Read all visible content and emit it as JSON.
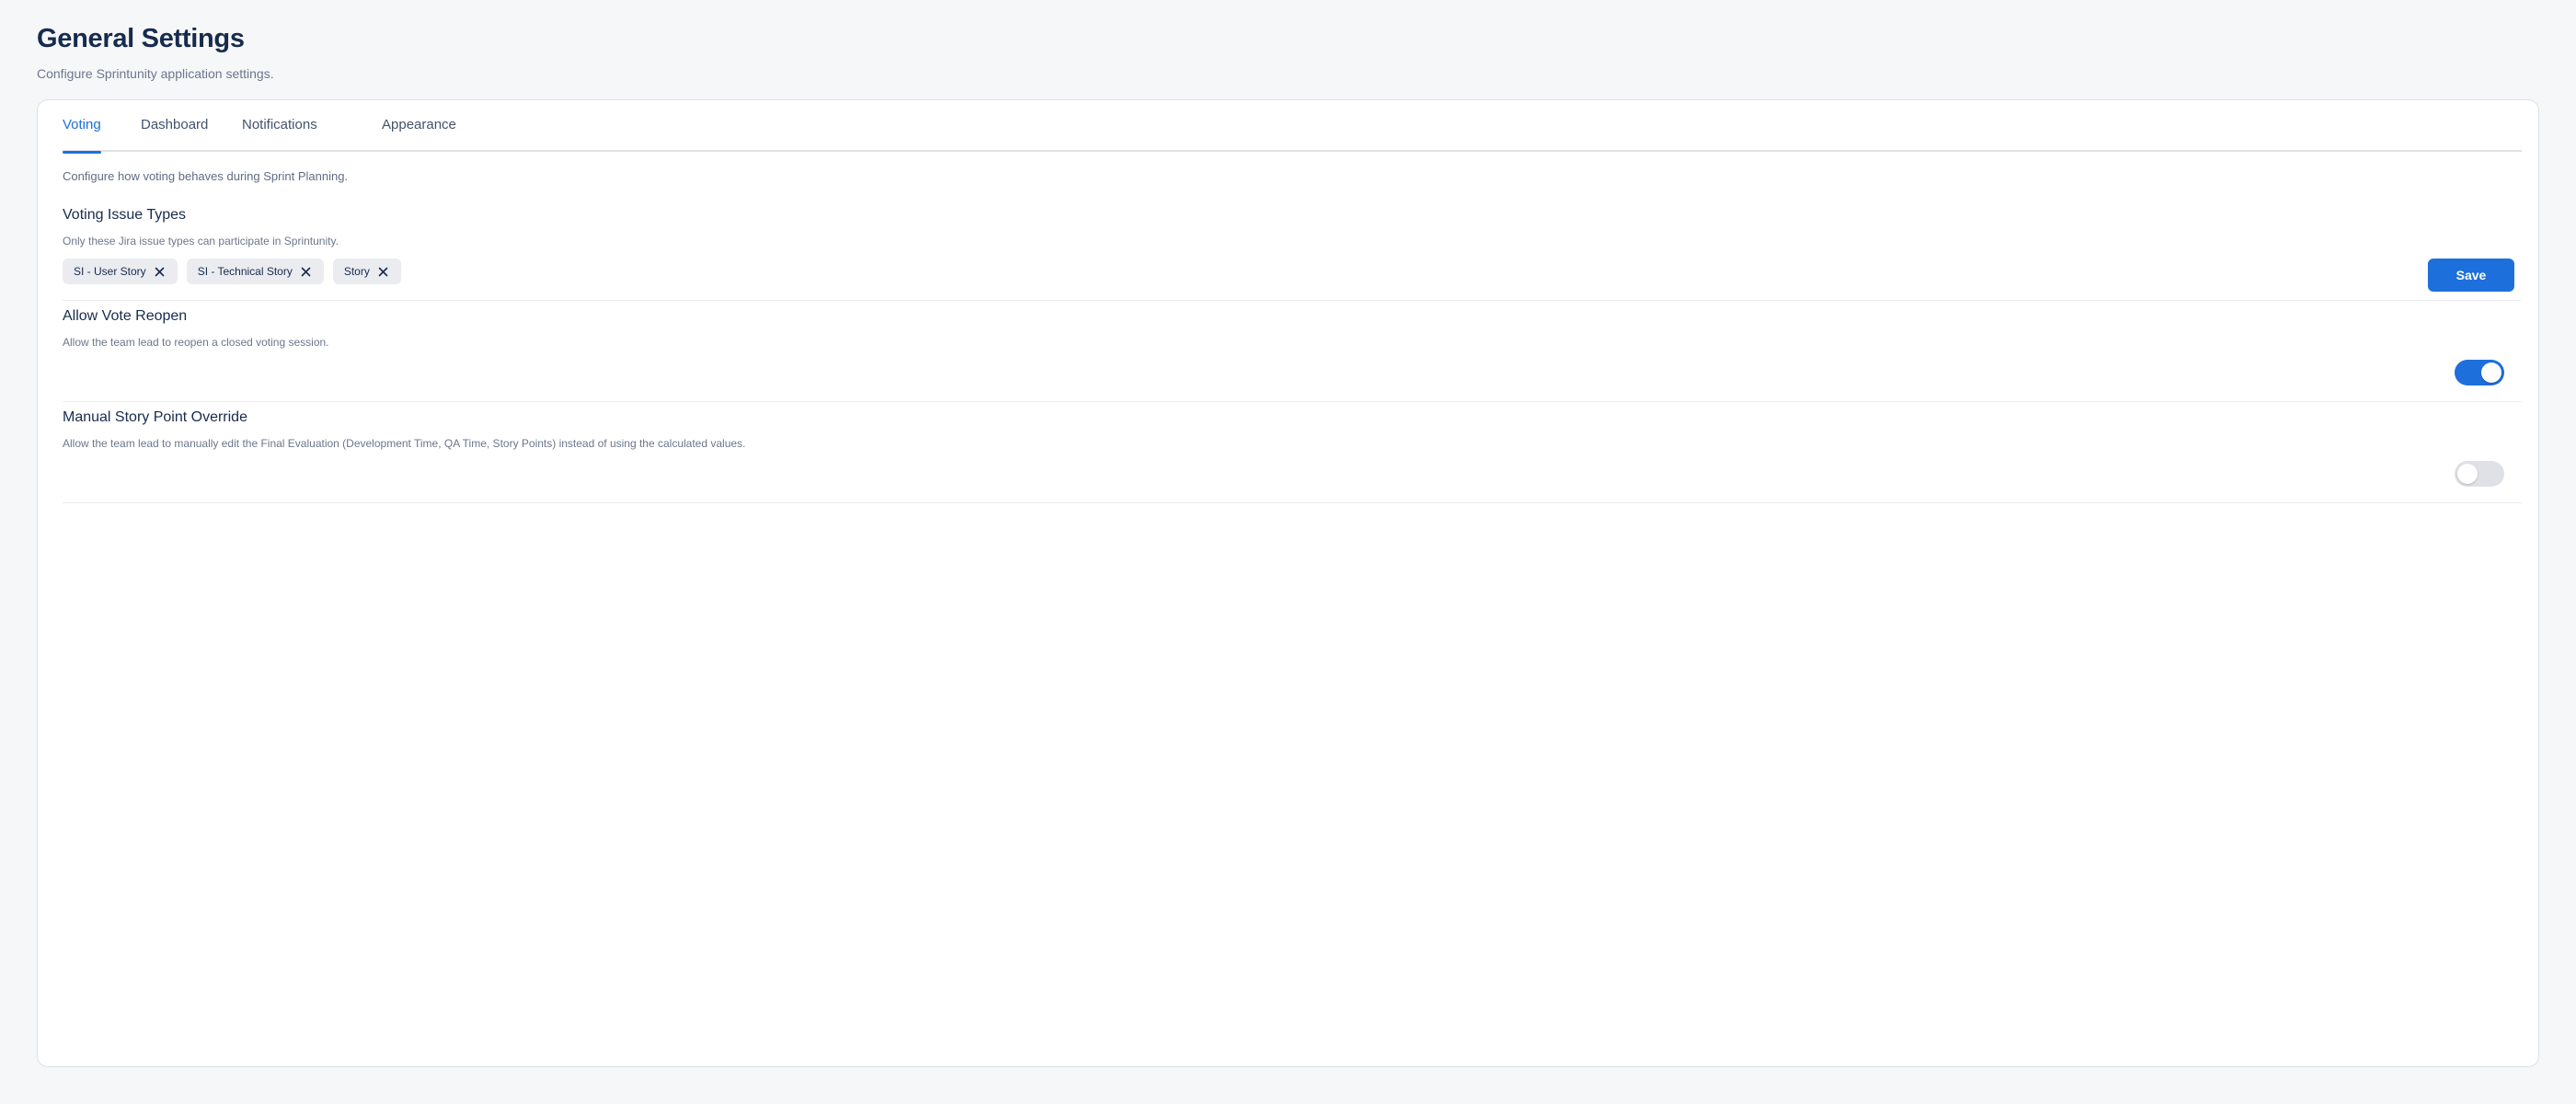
{
  "header": {
    "title": "General Settings",
    "subtitle": "Configure Sprintunity application settings."
  },
  "tabs": [
    {
      "label": "Voting",
      "active": true
    },
    {
      "label": "Dashboard",
      "active": false
    },
    {
      "label": "Notifications",
      "active": false
    },
    {
      "label": "Appearance",
      "active": false
    }
  ],
  "voting": {
    "intro": "Configure how voting behaves during Sprint Planning.",
    "issue_types": {
      "title": "Voting Issue Types",
      "description": "Only these Jira issue types can participate in Sprintunity.",
      "chips": [
        "SI - User Story",
        "SI - Technical Story",
        "Story"
      ],
      "remove_icon": "close-icon"
    },
    "save_label": "Save",
    "reopen": {
      "title": "Allow Vote Reopen",
      "description": "Allow the team lead to reopen a closed voting session.",
      "enabled": true
    },
    "override": {
      "title": "Manual Story Point Override",
      "description": "Allow the team lead to manually edit the Final Evaluation (Development Time, QA Time, Story Points) instead of using the calculated values.",
      "enabled": false
    }
  },
  "colors": {
    "accent": "#1d6fdc",
    "background": "#f6f7f9",
    "toggle_off": "#dfe1e6"
  }
}
